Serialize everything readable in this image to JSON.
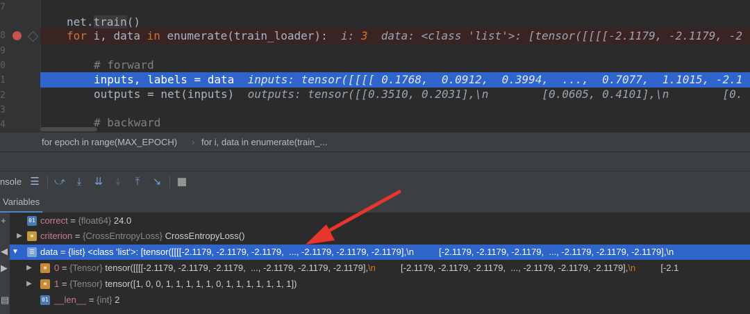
{
  "editor": {
    "line_numbers": [
      "7",
      "8",
      "9",
      "0",
      "1",
      "2",
      "3",
      "4"
    ],
    "lines": [
      {
        "pre": "net.",
        "fn": "train",
        "post": "()"
      },
      {
        "kw": "for",
        "a": " i, data ",
        "kw2": "in",
        "b": " enumerate(train_loader):",
        "hint_i_label": "i:",
        "hint_i_val": "3",
        "hint_data": "data: <class 'list'>: [tensor([[[[-2.1179, -2.1179, -2"
      },
      {
        "comment": "# forward"
      },
      {
        "code": "inputs, labels = data",
        "hint": "inputs: tensor([[[[ 0.1768,  0.0912,  0.3994,  ...,  0.7077,  1.1015, -2.1"
      },
      {
        "code": "outputs = net(inputs)",
        "hint": "outputs: tensor([[0.3510, 0.2031],\\n        [0.0605, 0.4101],\\n        [0."
      },
      {
        "comment": "# backward"
      }
    ]
  },
  "breadcrumb": {
    "item1": "for epoch in range(MAX_EPOCH)",
    "item2": "for i, data in enumerate(train_..."
  },
  "toolbar": {
    "console_label": "nsole",
    "icons": [
      "menu-icon",
      "show-execution-point-icon",
      "step-over-icon",
      "step-into-icon",
      "step-into-my-code-icon",
      "step-out-icon",
      "run-to-cursor-icon",
      "evaluate-expression-icon"
    ]
  },
  "variables": {
    "tab_label": "Variables",
    "side_symbols": [
      "+",
      "◀",
      "▶",
      "▤"
    ],
    "rows": [
      {
        "name": "correct",
        "eq": " = ",
        "type": "{float64}",
        "value": " 24.0"
      },
      {
        "name": "criterion",
        "eq": " = ",
        "type": "{CrossEntropyLoss}",
        "value": " CrossEntropyLoss()"
      },
      {
        "name": "data",
        "eq": " = {list} <class 'list'>: [tensor([[[[-2.1179, -2.1179, -2.1179,  ..., -2.1179, -2.1179, -2.1179],",
        "nl": "\\n",
        "value": "          [-2.1179, -2.1179, -2.1179,  ..., -2.1179, -2.1179, -2.1179],\\n"
      },
      {
        "name": "0",
        "eq": " = ",
        "type": "{Tensor}",
        "value": " tensor([[[[-2.1179, -2.1179, -2.1179,  ..., -2.1179, -2.1179, -2.1179],",
        "nl": "\\n",
        "tail": "          [-2.1179, -2.1179, -2.1179,  ..., -2.1179, -2.1179, -2.1179],",
        "nl2": "\\n",
        "tail2": "          [-2.1"
      },
      {
        "name": "1",
        "eq": " = ",
        "type": "{Tensor}",
        "value": " tensor([1, 0, 0, 1, 1, 1, 1, 1, 0, 1, 1, 1, 1, 1, 1, 1])"
      },
      {
        "name": "__len__",
        "eq": " = ",
        "type": "{int}",
        "value": " 2"
      }
    ]
  },
  "colors": {
    "selection": "#2f65ca",
    "breakpoint": "#c75450",
    "annotation_arrow": "#e8352e"
  }
}
